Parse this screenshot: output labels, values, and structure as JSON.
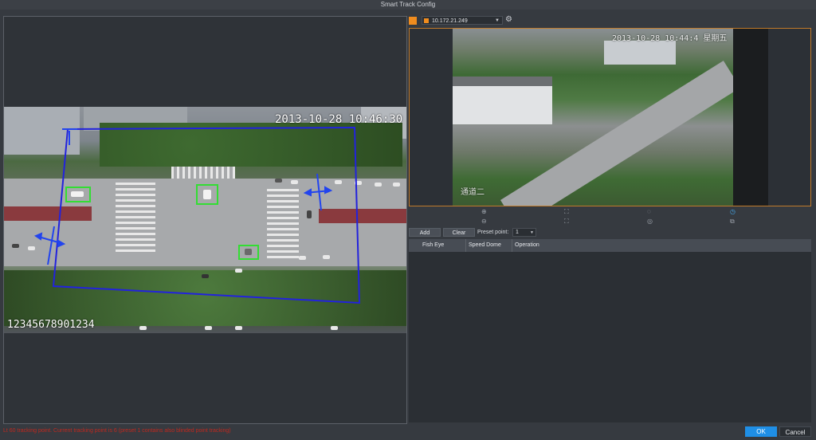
{
  "window": {
    "title": "Smart Track Config"
  },
  "fisheye": {
    "timestamp": "2013-10-28 10:46:30",
    "overlay_text": "12345678901234"
  },
  "dome": {
    "camera_select": "10.172.21.249",
    "overlay_text_top": "2013-10-28 10:44:4 星期五",
    "overlay_text_bottom": "通道二"
  },
  "controls": {
    "icons": [
      "zoom-in-icon",
      "zoom-out-icon",
      "focus-near-icon",
      "focus-far-icon",
      "iris-open-icon",
      "iris-close-icon",
      "auto-track-icon",
      "preset-icon"
    ]
  },
  "actions": {
    "add_label": "Add",
    "clear_label": "Clear",
    "preset_label": "Preset point:",
    "preset_value": "1"
  },
  "table": {
    "columns": [
      "Fish Eye",
      "Speed Dome",
      "Operation"
    ]
  },
  "status": {
    "error_text": "Lt 60 tracking point. Current tracking point is 6 (preset 1 contains also blinded point tracking)"
  },
  "footer": {
    "ok_label": "OK",
    "cancel_label": "Cancel"
  },
  "colors": {
    "accent": "#f08c1e",
    "primary": "#1f8fe6",
    "selection_box": "#2222dd",
    "target_box": "#33dd33",
    "error": "#c0281e"
  }
}
